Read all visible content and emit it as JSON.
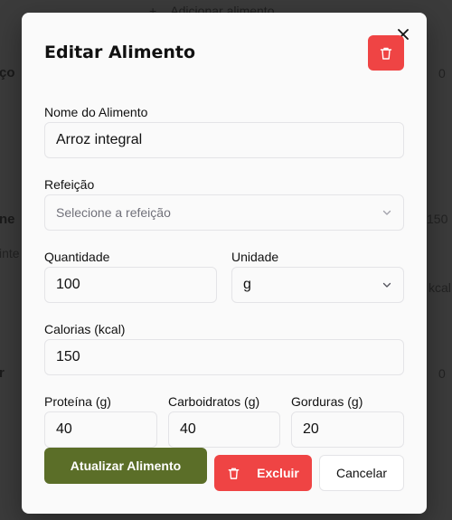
{
  "background": {
    "add_food": "Adicionar alimento",
    "fragments": [
      "ço",
      "0",
      "ne",
      "150",
      "inte",
      "kcal",
      "r",
      "0"
    ]
  },
  "modal": {
    "title": "Editar Alimento",
    "fields": {
      "name": {
        "label": "Nome do Alimento",
        "value": "Arroz integral"
      },
      "meal": {
        "label": "Refeição",
        "placeholder": "Selecione a refeição"
      },
      "quantity": {
        "label": "Quantidade",
        "value": "100"
      },
      "unit": {
        "label": "Unidade",
        "value": "g"
      },
      "calories": {
        "label": "Calorias (kcal)",
        "value": "150"
      },
      "protein": {
        "label": "Proteína (g)",
        "value": "40"
      },
      "carbs": {
        "label": "Carboidratos (g)",
        "value": "40"
      },
      "fat": {
        "label": "Gorduras (g)",
        "value": "20"
      }
    },
    "buttons": {
      "update": "Atualizar Alimento",
      "delete": "Excluir",
      "cancel": "Cancelar"
    }
  },
  "colors": {
    "primary": "#5b6e28",
    "danger": "#ef4444"
  }
}
